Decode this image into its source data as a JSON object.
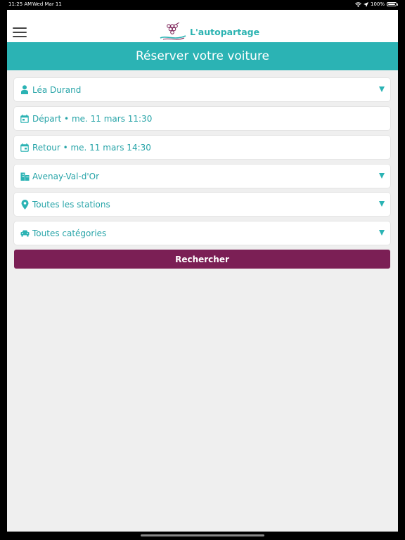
{
  "status_bar": {
    "time": "11:25 AM",
    "date": "Wed Mar 11",
    "battery": "100%"
  },
  "header": {
    "logo_text": "L'autopartage"
  },
  "page": {
    "title": "Réserver votre voiture"
  },
  "form": {
    "fields": [
      {
        "label": "Léa Durand",
        "icon": "user-icon",
        "dropdown": true
      },
      {
        "label": "Départ • me. 11 mars 11:30",
        "icon": "calendar-start-icon",
        "dropdown": false
      },
      {
        "label": "Retour • me. 11 mars 14:30",
        "icon": "calendar-end-icon",
        "dropdown": false
      },
      {
        "label": "Avenay-Val-d'Or",
        "icon": "city-icon",
        "dropdown": true
      },
      {
        "label": "Toutes les stations",
        "icon": "map-pin-icon",
        "dropdown": true
      },
      {
        "label": "Toutes catégories",
        "icon": "car-icon",
        "dropdown": true
      }
    ],
    "search_label": "Rechercher"
  },
  "colors": {
    "accent": "#2bb3b4",
    "button": "#7b1f55",
    "background": "#efefef"
  }
}
